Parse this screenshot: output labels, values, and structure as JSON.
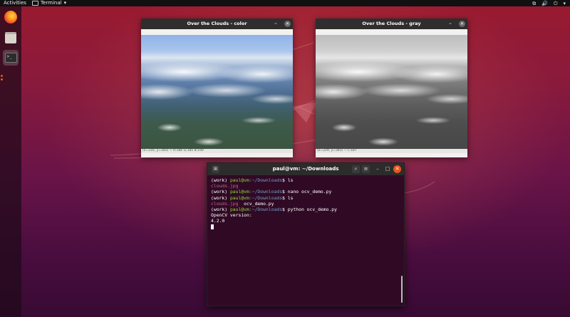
{
  "topbar": {
    "activities": "Activities",
    "app_menu": "Terminal",
    "app_menu_arrow": "▾",
    "tray_network": "⧉",
    "tray_volume": "🔊",
    "tray_power": "⏻",
    "tray_arrow": "▾"
  },
  "dock": {
    "items": [
      {
        "name": "Firefox",
        "icon": "firefox-icon"
      },
      {
        "name": "Files",
        "icon": "folder-icon"
      },
      {
        "name": "Terminal",
        "icon": "terminal-icon",
        "glyph": ">_"
      }
    ]
  },
  "windows": {
    "color": {
      "title": "Over the Clouds - color",
      "min": "–",
      "close": "✕",
      "status": "(x=216, y=283) ~ R:186 G:185 B:190"
    },
    "gray": {
      "title": "Over the Clouds - gray",
      "min": "–",
      "close": "✕",
      "status": "(x=229, y=281) ~ L:187"
    }
  },
  "terminal": {
    "title": "paul@vm: ~/Downloads",
    "buttons": {
      "new_tab": "⊞",
      "search": "⌕",
      "menu": "≡",
      "min": "–",
      "max": "□",
      "close": "✕"
    },
    "prompt_env": "(work) ",
    "prompt_user": "paul@vm",
    "prompt_path": ":~/Downloads",
    "prompt_dollar": "$ ",
    "lines": [
      {
        "cmd": "ls"
      },
      {
        "output_file": "clouds.jpg"
      },
      {
        "cmd": "nano ocv_demo.py"
      },
      {
        "cmd": "ls"
      },
      {
        "output_file": "clouds.jpg",
        "output_rest": "  ocv_demo.py"
      },
      {
        "cmd": "python ocv_demo.py"
      },
      {
        "output": "OpenCV version:"
      },
      {
        "output": "4.2.0"
      }
    ]
  },
  "colors": {
    "accent": "#e95420",
    "terminal_bg": "#300a24",
    "prompt_green": "#8ae234",
    "prompt_blue": "#729fcf"
  }
}
